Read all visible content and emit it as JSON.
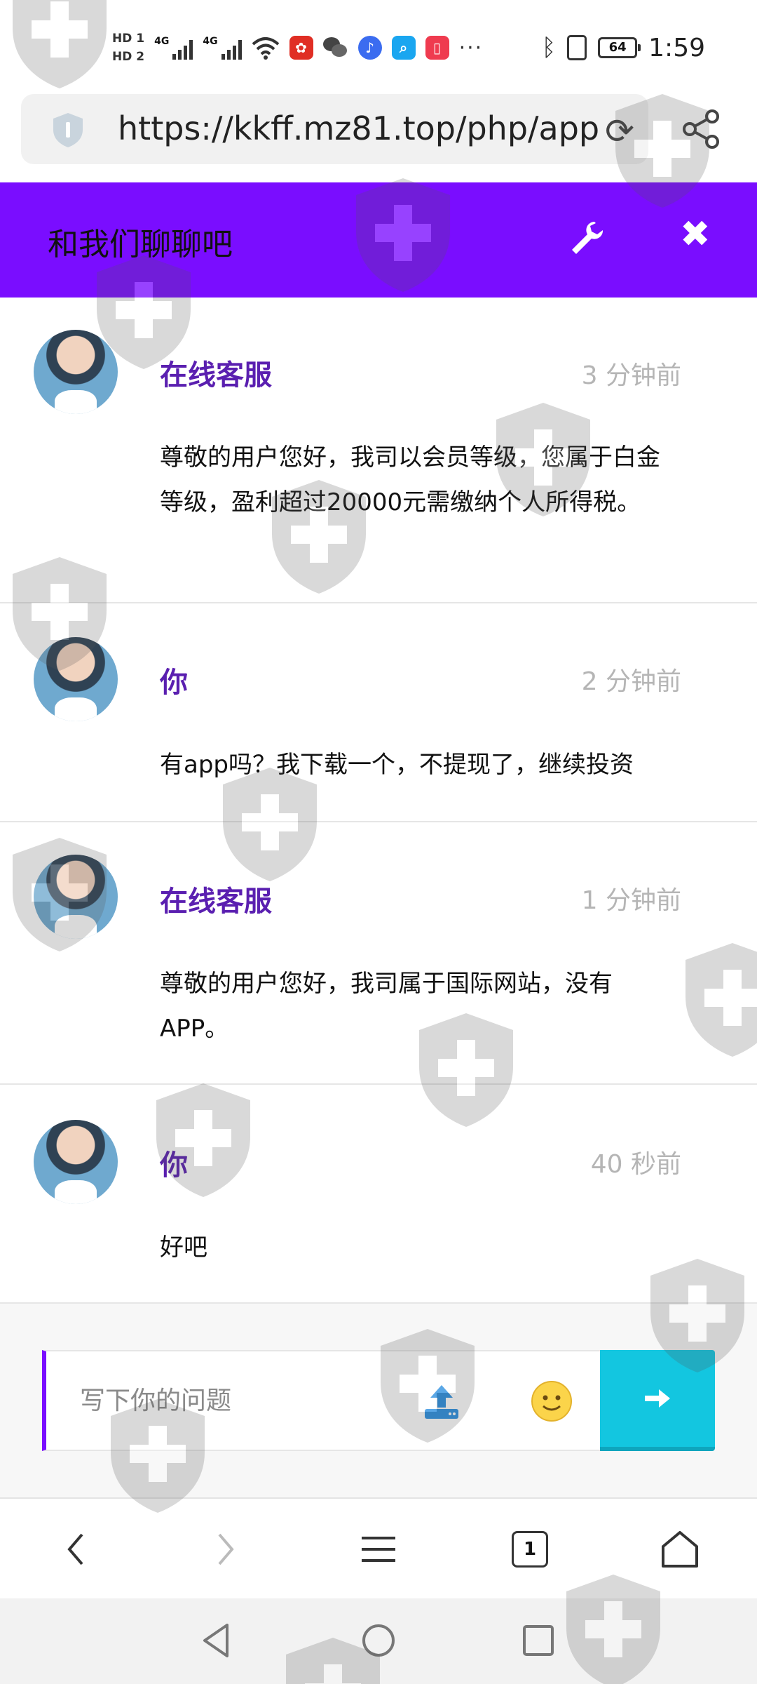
{
  "status_bar": {
    "hd_1": "HD 1",
    "hd_2": "HD 2",
    "signal_1": "4G",
    "signal_2": "4G",
    "more": "···",
    "battery": "64",
    "time": "1:59"
  },
  "browser": {
    "url": "https://kkff.mz81.top/php/app",
    "tab_count": "1"
  },
  "chat": {
    "title": "和我们聊聊吧",
    "messages": [
      {
        "sender": "在线客服",
        "time": "3 分钟前",
        "text": "尊敬的用户您好，我司以会员等级，您属于白金等级，盈利超过20000元需缴纳个人所得税。"
      },
      {
        "sender": "你",
        "time": "2 分钟前",
        "text": "有app吗？我下载一个，不提现了，继续投资"
      },
      {
        "sender": "在线客服",
        "time": "1 分钟前",
        "text": "尊敬的用户您好，我司属于国际网站，没有APP。"
      },
      {
        "sender": "你",
        "time": "40 秒前",
        "text": "好吧"
      }
    ],
    "input_placeholder": "写下你的问题"
  },
  "colors": {
    "header_bg": "#7a0dff",
    "sender_color": "#5a1fb0",
    "send_button": "#13c6e0",
    "time_color": "#b5b5b5"
  },
  "icons": {
    "wrench": "wrench-icon",
    "close": "close-icon",
    "upload": "upload-icon",
    "emoji": "smiley-icon",
    "send": "arrow-right-icon"
  }
}
